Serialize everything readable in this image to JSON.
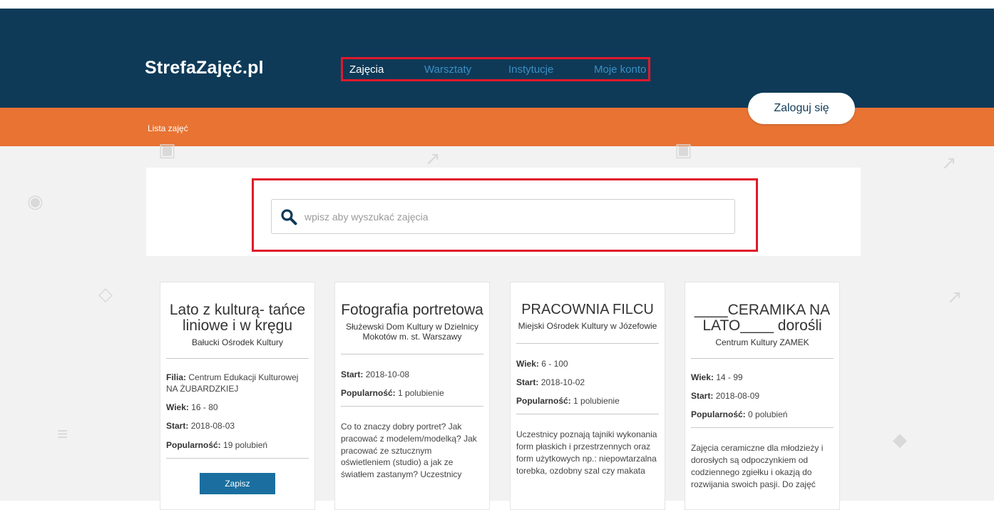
{
  "header": {
    "logo": "StrefaZajęć.pl",
    "nav": [
      "Zajęcia",
      "Warsztaty",
      "Instytucje",
      "Moje konto"
    ],
    "login_label": "Zaloguj się"
  },
  "breadcrumb": "Lista zajęć",
  "search": {
    "placeholder": "wpisz aby wyszukać zajęcia"
  },
  "cards": [
    {
      "title": "Lato z kulturą- tańce liniowe i w kręgu",
      "institution": "Bałucki Ośrodek Kultury",
      "filia_label": "Filia:",
      "filia_value": "Centrum Edukacji Kulturowej NA ŻUBARDZKIEJ",
      "wiek_label": "Wiek:",
      "wiek_value": "16 - 80",
      "start_label": "Start:",
      "start_value": "2018-08-03",
      "pop_label": "Popularność:",
      "pop_value": "19 polubień",
      "button": "Zapisz"
    },
    {
      "title": "Fotografia portretowa",
      "institution": "Służewski Dom Kultury w Dzielnicy Mokotów m. st. Warszawy",
      "start_label": "Start:",
      "start_value": "2018-10-08",
      "pop_label": "Popularność:",
      "pop_value": "1 polubienie",
      "description": "Co to znaczy dobry portret? Jak pracować z modelem/modelką? Jak pracować ze sztucznym oświetleniem (studio) a jak ze światłem zastanym? Uczestnicy"
    },
    {
      "title": "PRACOWNIA FILCU",
      "institution": "Miejski Ośrodek Kultury w Józefowie",
      "wiek_label": "Wiek:",
      "wiek_value": "6 - 100",
      "start_label": "Start:",
      "start_value": "2018-10-02",
      "pop_label": "Popularność:",
      "pop_value": "1 polubienie",
      "description": "Uczestnicy poznają tajniki wykonania form płaskich i przestrzennych oraz form użytkowych np.: niepowtarzalna torebka, ozdobny szal czy makata"
    },
    {
      "title": "____CERAMIKA NA LATO____ dorośli",
      "institution": "Centrum Kultury ZAMEK",
      "wiek_label": "Wiek:",
      "wiek_value": "14 - 99",
      "start_label": "Start:",
      "start_value": "2018-08-09",
      "pop_label": "Popularność:",
      "pop_value": "0 polubień",
      "description": "Zajęcia ceramiczne dla młodzieży i dorosłych są odpoczynkiem od codziennego zgiełku i okazją do rozwijania swoich pasji. Do zajęć"
    }
  ],
  "colors": {
    "header_bg": "#0e3a58",
    "orange_bar": "#e87333",
    "highlight": "#e0192b",
    "button": "#1a6fa0"
  },
  "icons": [
    "search-icon",
    "eye-icon",
    "translate-icon",
    "image-icon",
    "ruler-icon",
    "compass-icon",
    "tag-icon"
  ]
}
